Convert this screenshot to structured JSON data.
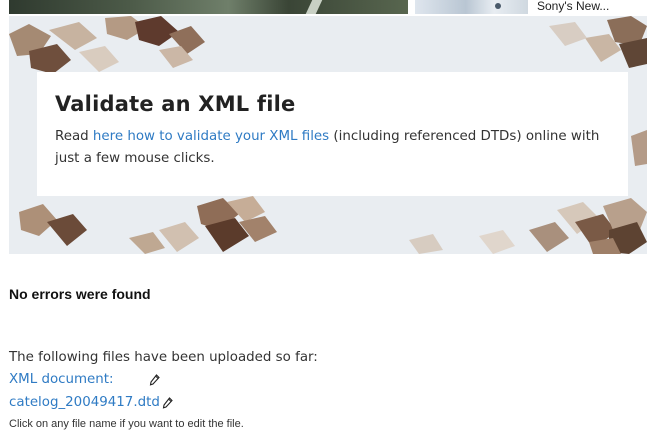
{
  "top": {
    "news_teaser": "Sony's New..."
  },
  "hero": {
    "title": "Validate an XML file",
    "text_before": "Read ",
    "link_text": "here how to validate your XML files",
    "text_after": " (including referenced DTDs) online with just a few mouse clicks."
  },
  "result": {
    "message": "No errors were found"
  },
  "files": {
    "intro": "The following files have been uploaded so far:",
    "items": [
      {
        "label": "XML document:",
        "edit_icon": "pencil-icon"
      },
      {
        "label": "catelog_20049417.dtd",
        "edit_icon": "pencil-icon"
      }
    ],
    "hint": "Click on any file name if you want to edit the file."
  },
  "colors": {
    "link": "#2f7bc4",
    "text": "#222222",
    "card_bg": "#ffffff"
  }
}
